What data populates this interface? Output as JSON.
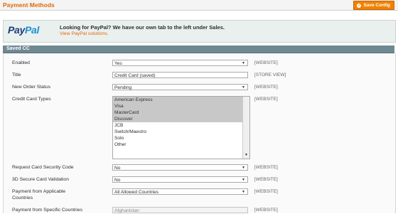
{
  "header": {
    "title": "Payment Methods",
    "save_label": "Save Config",
    "save_icon": "save-check-icon"
  },
  "paypal": {
    "logo_pay": "Pay",
    "logo_pal": "Pal",
    "message": "Looking for PayPal? We have our own tab to the left under Sales.",
    "link": "View PayPal solutions."
  },
  "section": {
    "title": "Saved CC"
  },
  "fields": {
    "enabled": {
      "label": "Enabled",
      "value": "Yes",
      "scope": "[WEBSITE]"
    },
    "title": {
      "label": "Title",
      "value": "Credit Card (saved)",
      "scope": "[STORE VIEW]"
    },
    "order_status": {
      "label": "New Order Status",
      "value": "Pending",
      "scope": "[WEBSITE]"
    },
    "cc_types": {
      "label": "Credit Card Types",
      "scope": "[WEBSITE]",
      "options": [
        "American Express",
        "Visa",
        "MasterCard",
        "Discover",
        "JCB",
        "Switch/Maestro",
        "Solo",
        "Other"
      ],
      "selected": [
        true,
        true,
        true,
        true,
        false,
        false,
        false,
        false
      ]
    },
    "security_code": {
      "label": "Request Card Security Code",
      "value": "No",
      "scope": "[WEBSITE]"
    },
    "secure_3d": {
      "label": "3D Secure Card Validation",
      "value": "No",
      "scope": "[WEBSITE]"
    },
    "applicable_countries": {
      "label": "Payment from Applicable",
      "label2": "Countries",
      "value": "All Allowed Countries",
      "scope": "[WEBSITE]"
    },
    "specific_countries": {
      "label": "Payment from Specific Countries",
      "value": "Afghanistan",
      "scope": "[WEBSITE]"
    }
  },
  "colors": {
    "accent": "#e26703",
    "button": "#f18200",
    "section_header": "#6f8992",
    "selected_option": "#c8c8c8"
  }
}
